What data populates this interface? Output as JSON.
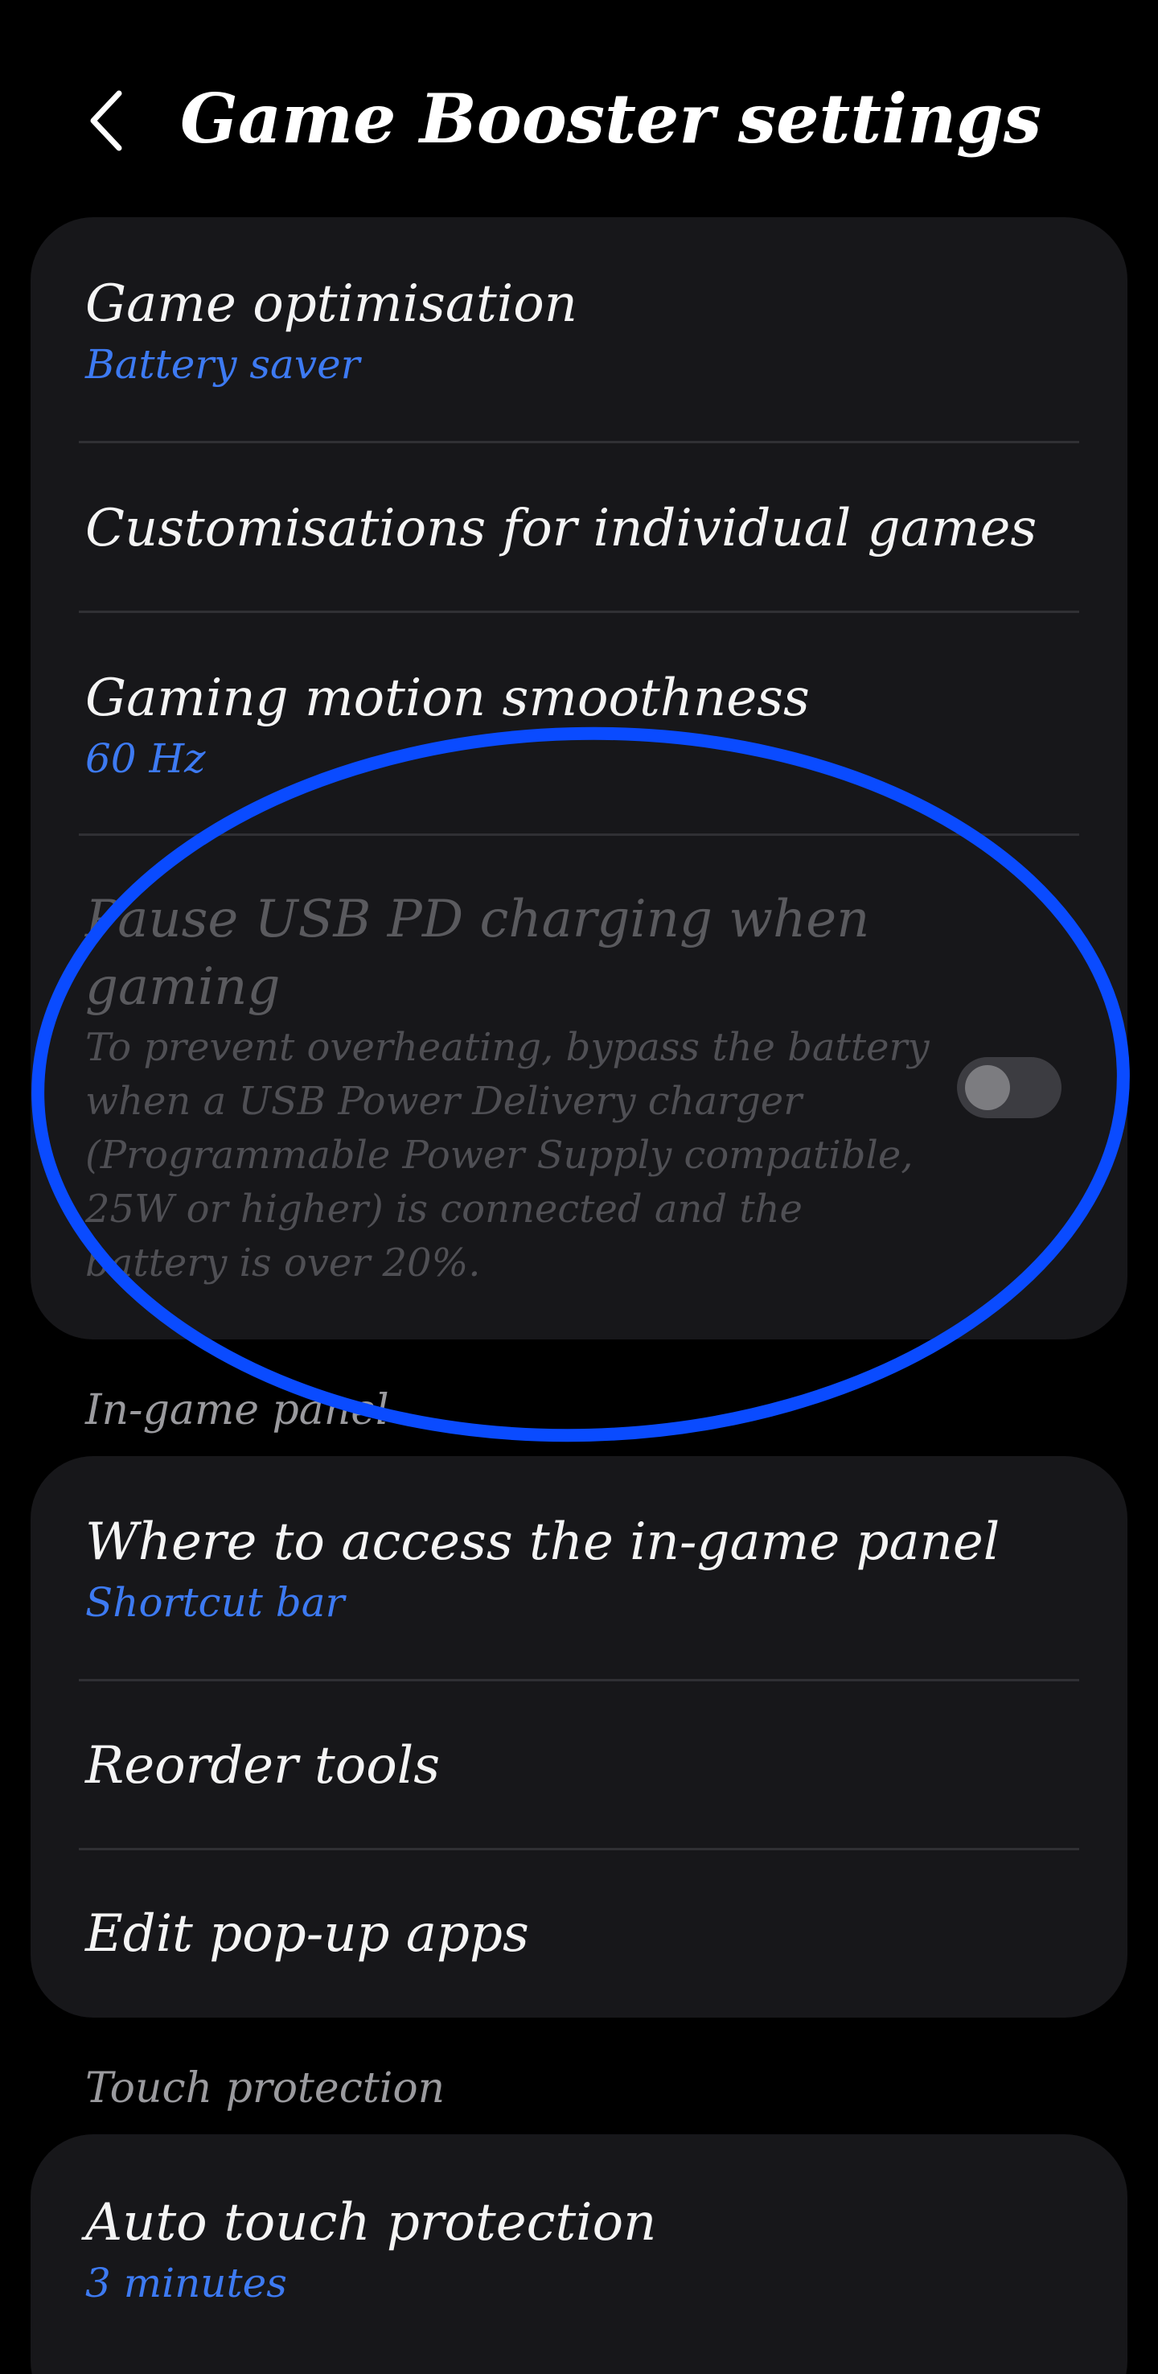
{
  "header": {
    "title": "Game Booster settings"
  },
  "card1": {
    "items": [
      {
        "label": "Game optimisation",
        "sub": "Battery saver"
      },
      {
        "label": "Customisations for individual games"
      },
      {
        "label": "Gaming motion smoothness",
        "sub": "60 Hz"
      },
      {
        "label_line1": "Pause USB PD charging when",
        "label_line2": "gaming",
        "desc": "To prevent overheating, bypass the battery when a USB Power Delivery charger (Programmable Power Supply compatible, 25W or higher) is connected and the battery is over 20%.",
        "toggle_on": false
      }
    ]
  },
  "sections": {
    "in_game_panel": "In-game panel",
    "touch_protection": "Touch protection"
  },
  "card2": {
    "items": [
      {
        "label": "Where to access the in-game panel",
        "sub": "Shortcut bar"
      },
      {
        "label": "Reorder tools"
      },
      {
        "label": "Edit pop-up apps"
      }
    ]
  },
  "card3": {
    "items": [
      {
        "label": "Auto touch protection",
        "sub": "3 minutes"
      }
    ]
  },
  "colors": {
    "background": "#000000",
    "card": "#17171a",
    "accent_sub": "#3d7af2",
    "annotation_ellipse": "#0a4bff"
  },
  "icons": {
    "back": "chevron-left-icon"
  }
}
